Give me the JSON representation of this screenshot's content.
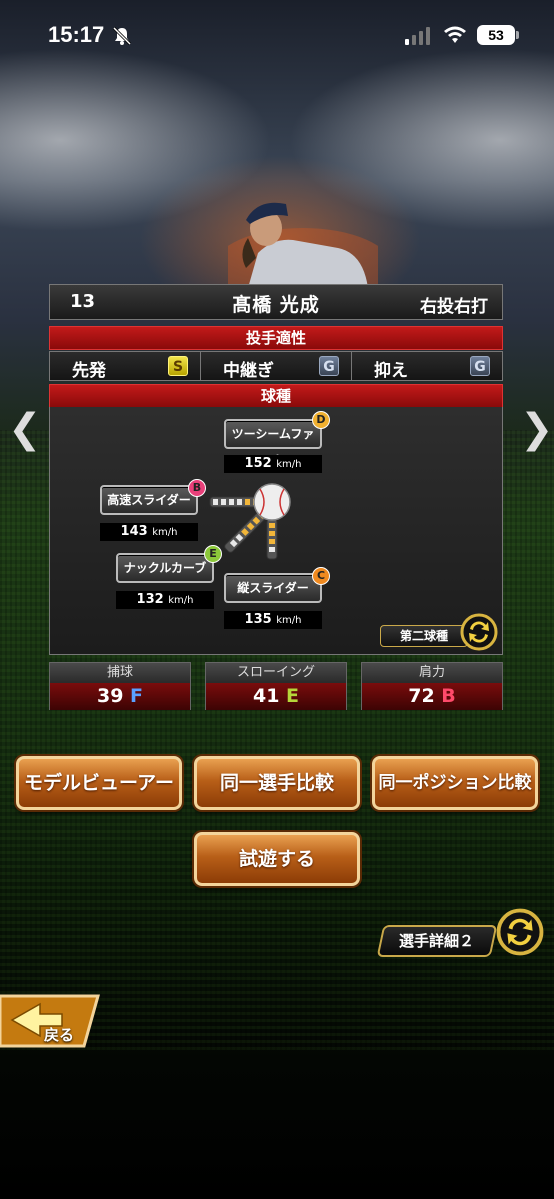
{
  "status_bar": {
    "time": "15:17",
    "battery": "53"
  },
  "player": {
    "number": "13",
    "name": "髙橋 光成",
    "handedness": "右投右打"
  },
  "aptitude": {
    "title": "投手適性",
    "cells": [
      {
        "label": "先発",
        "grade": "S"
      },
      {
        "label": "中継ぎ",
        "grade": "G"
      },
      {
        "label": "抑え",
        "grade": "G"
      }
    ]
  },
  "pitches": {
    "title": "球種",
    "items": [
      {
        "name": "ツーシームファスト",
        "grade": "D",
        "speed": "152",
        "unit": "km/h"
      },
      {
        "name": "高速スライダー",
        "grade": "B",
        "speed": "143",
        "unit": "km/h"
      },
      {
        "name": "ナックルカーブ",
        "grade": "E",
        "speed": "132",
        "unit": "km/h"
      },
      {
        "name": "縦スライダー",
        "grade": "C",
        "speed": "135",
        "unit": "km/h"
      }
    ],
    "second_pitch_label": "第二球種"
  },
  "stats": [
    {
      "label": "捕球",
      "value": "39",
      "grade": "F"
    },
    {
      "label": "スローイング",
      "value": "41",
      "grade": "E"
    },
    {
      "label": "肩力",
      "value": "72",
      "grade": "B"
    }
  ],
  "buttons": {
    "model_viewer": "モデルビューアー",
    "same_player": "同一選手比較",
    "same_position": "同一ポジション比較",
    "try_play": "試遊する",
    "detail": "選手詳細２",
    "back": "戻る"
  },
  "colors": {
    "panel_red": "#c21a1a",
    "orange_button": "#b85f18",
    "grade_D": "#f0b030",
    "grade_B": "#e8407a",
    "grade_E": "#8cc83a",
    "grade_C": "#f08a20"
  },
  "icons": {
    "left_arrow": "chevron-left-icon",
    "right_arrow": "chevron-right-icon",
    "swap": "swap-icon",
    "mute": "bell-slash-icon",
    "signal": "cellular-signal-icon",
    "wifi": "wifi-icon",
    "back": "back-arrow-icon"
  }
}
